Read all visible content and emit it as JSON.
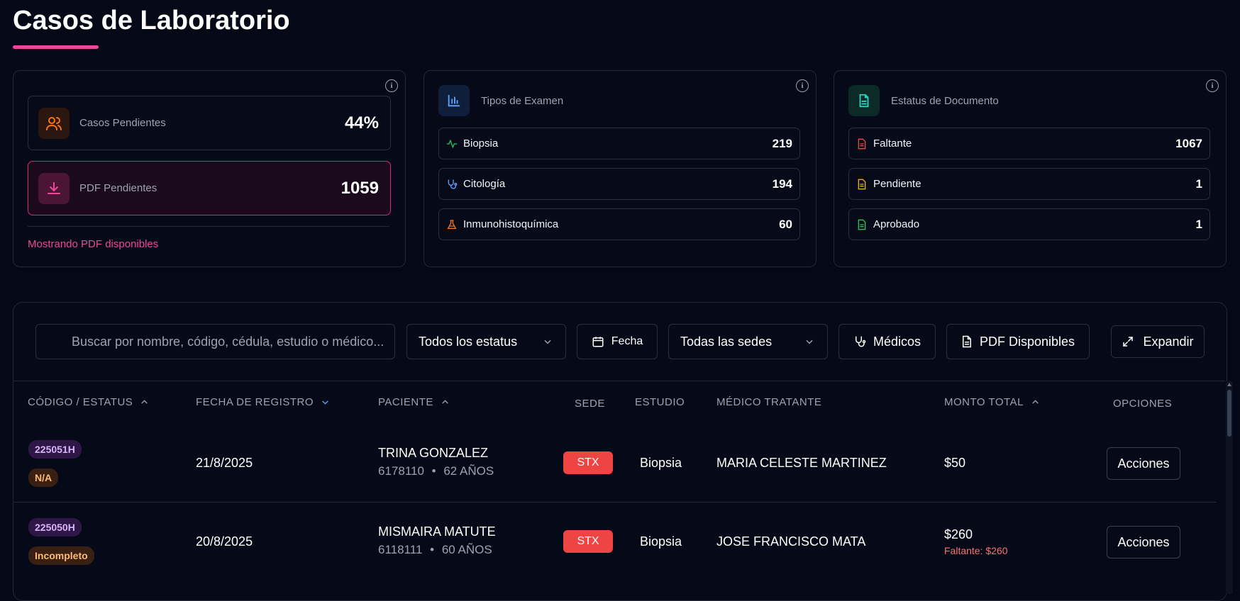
{
  "page": {
    "title": "Casos de Laboratorio"
  },
  "summary": {
    "casos_pendientes": {
      "label": "Casos Pendientes",
      "value": "44%",
      "icon": "users-icon"
    },
    "pdf_pendientes": {
      "label": "PDF Pendientes",
      "value": "1059",
      "icon": "download-icon"
    },
    "note": "Mostrando PDF disponibles"
  },
  "tipos_examen": {
    "title": "Tipos de Examen",
    "items": [
      {
        "label": "Biopsia",
        "value": "219",
        "icon": "activity-icon",
        "color": "#22c55e"
      },
      {
        "label": "Citología",
        "value": "194",
        "icon": "stethoscope-icon",
        "color": "#60a5fa"
      },
      {
        "label": "Inmunohistoquímica",
        "value": "60",
        "icon": "flask-icon",
        "color": "#f97316"
      }
    ]
  },
  "estatus_documento": {
    "title": "Estatus de Documento",
    "items": [
      {
        "label": "Faltante",
        "value": "1067",
        "icon": "file-icon",
        "color": "#ef4444"
      },
      {
        "label": "Pendiente",
        "value": "1",
        "icon": "file-icon",
        "color": "#eab308"
      },
      {
        "label": "Aprobado",
        "value": "1",
        "icon": "file-icon",
        "color": "#22c55e"
      }
    ]
  },
  "filters": {
    "search_placeholder": "Buscar por nombre, código, cédula, estudio o médico...",
    "status_select": "Todos los estatus",
    "date_label": "Fecha",
    "sede_select": "Todas las sedes",
    "medicos_label": "Médicos",
    "pdf_label": "PDF Disponibles",
    "expand_label": "Expandir"
  },
  "table": {
    "headers": {
      "codigo": "CÓDIGO / ESTATUS",
      "fecha": "FECHA DE REGISTRO",
      "paciente": "PACIENTE",
      "sede": "SEDE",
      "estudio": "ESTUDIO",
      "medico": "MÉDICO TRATANTE",
      "monto": "MONTO TOTAL",
      "opciones": "OPCIONES"
    },
    "rows": [
      {
        "code": "225051H",
        "status": "N/A",
        "fecha": "21/8/2025",
        "paciente": "TRINA GONZALEZ",
        "cedula": "6178110",
        "edad": "62 AÑOS",
        "sede": "STX",
        "estudio": "Biopsia",
        "medico": "MARIA CELESTE MARTINEZ",
        "monto": "$50",
        "faltante": "",
        "accion": "Acciones"
      },
      {
        "code": "225050H",
        "status": "Incompleto",
        "fecha": "20/8/2025",
        "paciente": "MISMAIRA MATUTE",
        "cedula": "6118111",
        "edad": "60 AÑOS",
        "sede": "STX",
        "estudio": "Biopsia",
        "medico": "JOSE FRANCISCO MATA",
        "monto": "$260",
        "faltante": "Faltante: $260",
        "accion": "Acciones"
      }
    ],
    "separator": "•"
  },
  "colors": {
    "accent": "#ec4899",
    "background": "#050816",
    "danger": "#ef4444"
  }
}
